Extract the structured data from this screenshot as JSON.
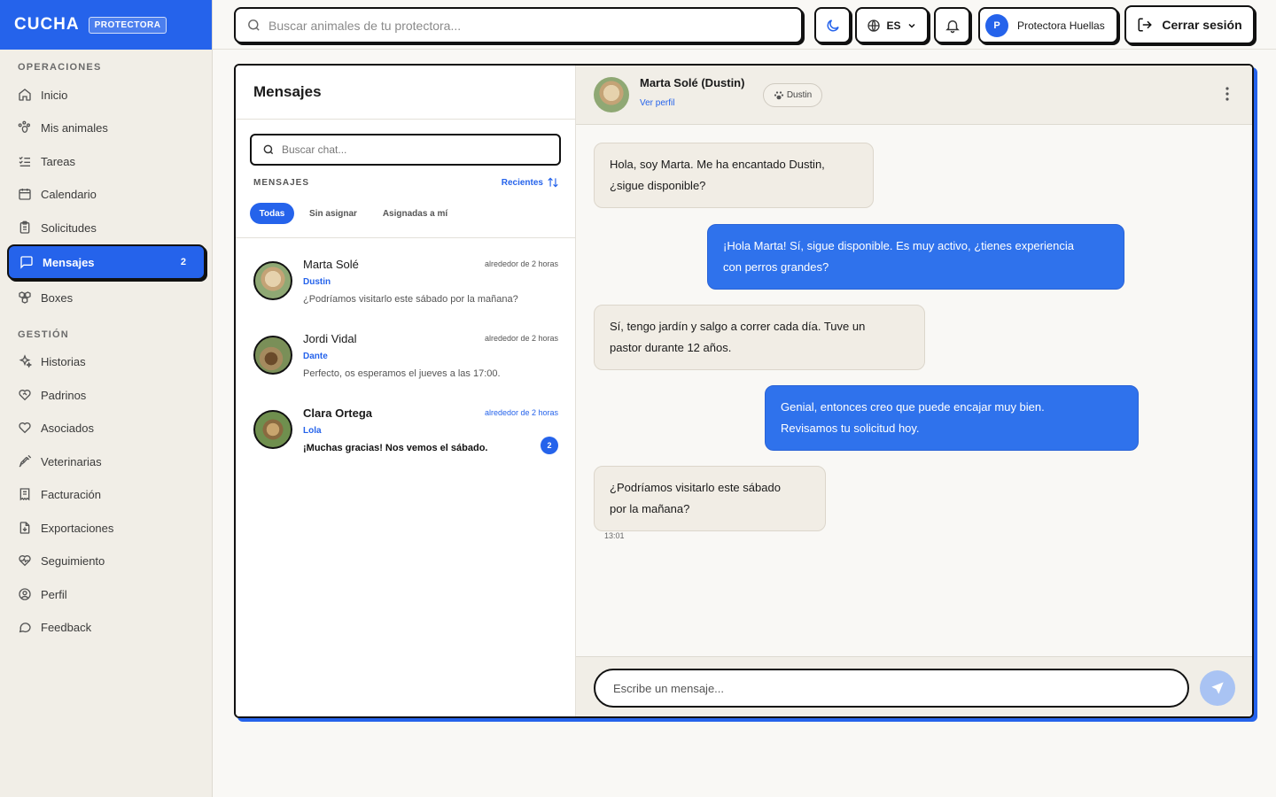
{
  "brand": {
    "name": "CUCHA",
    "badge": "PROTECTORA",
    "color": "#2563eb"
  },
  "sidebar": {
    "sections": [
      {
        "title": "OPERACIONES"
      },
      {
        "title": "GESTIÓN"
      }
    ],
    "items": [
      {
        "label": "Inicio",
        "icon": "home-icon"
      },
      {
        "label": "Mis animales",
        "icon": "paw-icon"
      },
      {
        "label": "Tareas",
        "icon": "list-check-icon"
      },
      {
        "label": "Calendario",
        "icon": "calendar-icon"
      },
      {
        "label": "Solicitudes",
        "icon": "clipboard-icon"
      },
      {
        "label": "Mensajes",
        "icon": "message-square-icon",
        "badge": "2",
        "active": true
      },
      {
        "label": "Boxes",
        "icon": "boxes-icon"
      },
      {
        "label": "Historias",
        "icon": "sparkles-icon"
      },
      {
        "label": "Padrinos",
        "icon": "heart-handshake-icon"
      },
      {
        "label": "Asociados",
        "icon": "heart-icon"
      },
      {
        "label": "Veterinarias",
        "icon": "syringe-icon"
      },
      {
        "label": "Facturación",
        "icon": "receipt-icon"
      },
      {
        "label": "Exportaciones",
        "icon": "file-download-icon"
      },
      {
        "label": "Seguimiento",
        "icon": "heart-pulse-icon"
      },
      {
        "label": "Perfil",
        "icon": "user-circle-icon"
      },
      {
        "label": "Feedback",
        "icon": "message-circle-icon"
      }
    ]
  },
  "topbar": {
    "search_placeholder": "Buscar animales de tu protectora...",
    "language": "ES",
    "user_initial": "P",
    "user_name": "Protectora Huellas",
    "logout_label": "Cerrar sesión"
  },
  "messages_list": {
    "title": "Mensajes",
    "search_placeholder": "Buscar chat...",
    "section_label": "MENSAJES",
    "sort_label": "Recientes",
    "filters": [
      "Todas",
      "Sin asignar",
      "Asignadas a mí"
    ],
    "conversations": [
      {
        "name": "Marta Solé",
        "time": "alrededor de 2 horas",
        "animal": "Dustin",
        "preview": "¿Podríamos visitarlo este sábado por la mañana?",
        "unread": false
      },
      {
        "name": "Jordi Vidal",
        "time": "alrededor de 2 horas",
        "animal": "Dante",
        "preview": "Perfecto, os esperamos el jueves a las 17:00.",
        "unread": false
      },
      {
        "name": "Clara Ortega",
        "time": "alrededor de 2 horas",
        "animal": "Lola",
        "preview": "¡Muchas gracias! Nos vemos el sábado.",
        "unread": true,
        "unread_count": "2"
      }
    ]
  },
  "chat": {
    "contact_name": "Marta Solé (Dustin)",
    "profile_link": "Ver perfil",
    "animal_tag": "Dustin",
    "messages": [
      {
        "direction": "in",
        "lines": [
          "Hola, soy Marta. Me ha encantado Dustin,",
          "¿sigue disponible?"
        ]
      },
      {
        "direction": "out",
        "lines": [
          "¡Hola Marta! Sí, sigue disponible. Es muy activo, ¿tienes experiencia",
          "con perros grandes?"
        ]
      },
      {
        "direction": "in",
        "lines": [
          "Sí, tengo jardín y salgo a correr cada día. Tuve un",
          "pastor durante 12 años."
        ]
      },
      {
        "direction": "out",
        "lines": [
          "Genial, entonces creo que puede encajar muy bien.",
          "Revisamos tu solicitud hoy."
        ]
      },
      {
        "direction": "in",
        "lines": [
          "¿Podríamos visitarlo este sábado",
          "por la mañana?"
        ]
      }
    ],
    "last_time": "13:01",
    "composer_placeholder": "Escribe un mensaje..."
  }
}
